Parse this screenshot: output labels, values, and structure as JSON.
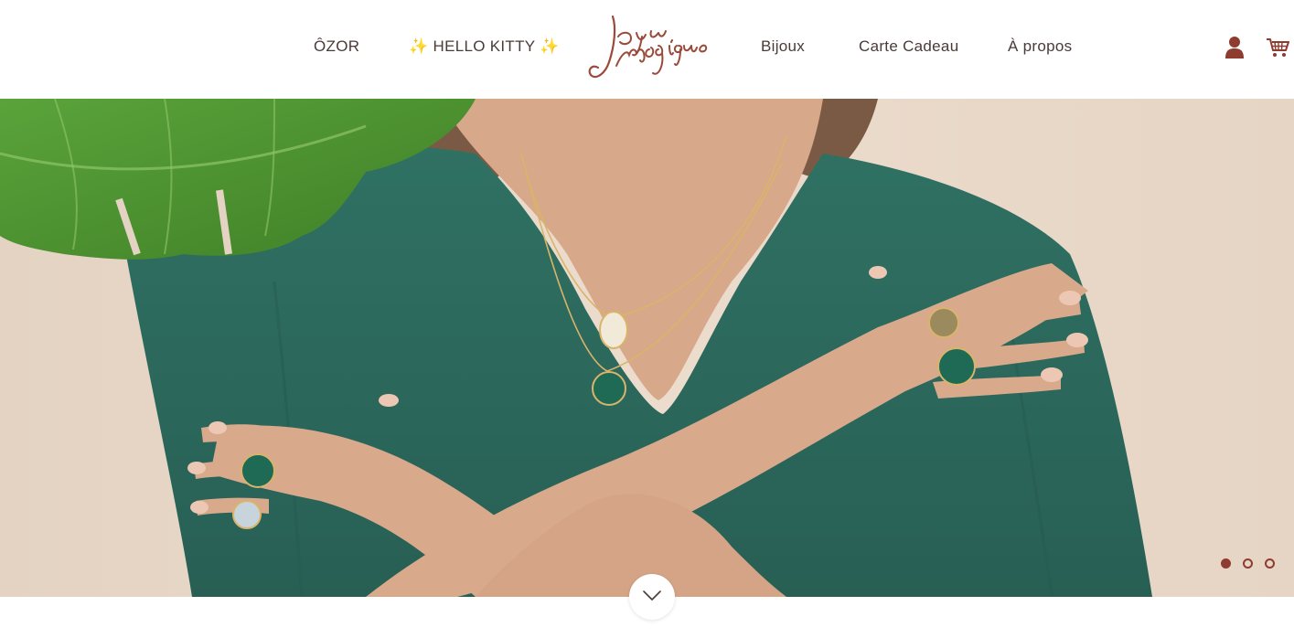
{
  "nav": {
    "ozor": "ÔZOR",
    "hello_kitty": "✨ HELLO KITTY ✨",
    "bijoux": "Bijoux",
    "carte_cadeau": "Carte Cadeau",
    "a_propos": "À propos"
  },
  "logo": {
    "text": "Joyau Magique"
  },
  "icons": {
    "account": "user-icon",
    "cart": "shopping-cart-icon",
    "scroll": "chevron-down-icon"
  },
  "carousel": {
    "slides": 3,
    "active_index": 0
  },
  "colors": {
    "brand": "#8e3b30",
    "nav_text": "#4a3b38",
    "hero_background": "#e9d8c8",
    "shirt": "#2e6b5e"
  }
}
